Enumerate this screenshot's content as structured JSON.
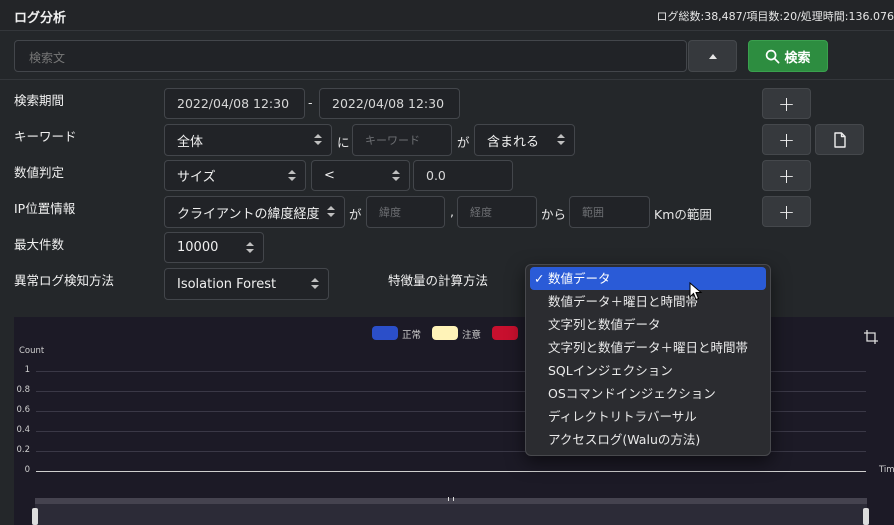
{
  "app": {
    "title": "ログ分析",
    "stats": "ログ総数:38,487/項目数:20/処理時間:136.076"
  },
  "search": {
    "placeholder": "検索文",
    "button_label": "検索"
  },
  "filters": {
    "period": {
      "label": "検索期間",
      "from": "2022/04/08 12:30",
      "separator": "-",
      "to": "2022/04/08 12:30"
    },
    "keyword": {
      "label": "キーワード",
      "scope": "全体",
      "ni": "に",
      "placeholder": "キーワード",
      "ga": "が",
      "condition": "含まれる"
    },
    "numeric": {
      "label": "数値判定",
      "field": "サイズ",
      "operator": "<",
      "value": "0.0"
    },
    "geo": {
      "label": "IP位置情報",
      "field": "クライアントの緯度経度",
      "ga": "が",
      "lat_placeholder": "緯度",
      "comma": ",",
      "lon_placeholder": "経度",
      "kara": "から",
      "range_placeholder": "範囲",
      "suffix": "Kmの範囲"
    },
    "max_count": {
      "label": "最大件数",
      "value": "10000"
    },
    "anomaly": {
      "label": "異常ログ検知方法",
      "method": "Isolation Forest",
      "feature_label": "特徴量の計算方法"
    }
  },
  "buttons": {
    "plus": "+"
  },
  "feature_dropdown": {
    "selected_index": 0,
    "options": [
      "数値データ",
      "数値データ＋曜日と時間帯",
      "文字列と数値データ",
      "文字列と数値データ＋曜日と時間帯",
      "SQLインジェクション",
      "OSコマンドインジェクション",
      "ディレクトリトラバーサル",
      "アクセスログ(Waluの方法)"
    ],
    "check_mark": "✓"
  },
  "chart": {
    "legend": [
      {
        "label": "正常",
        "color": "#2b4fc9"
      },
      {
        "label": "注意",
        "color": "#fff3b8"
      },
      {
        "label": "",
        "color": "#c8102e"
      }
    ],
    "y_axis_label": "Count",
    "y_ticks": [
      "1",
      "0.8",
      "0.6",
      "0.4",
      "0.2",
      "0"
    ],
    "x_axis_label": "Tim"
  },
  "colors": {
    "accent_green": "#2d8d40",
    "selected_blue": "#2a5bd7"
  }
}
